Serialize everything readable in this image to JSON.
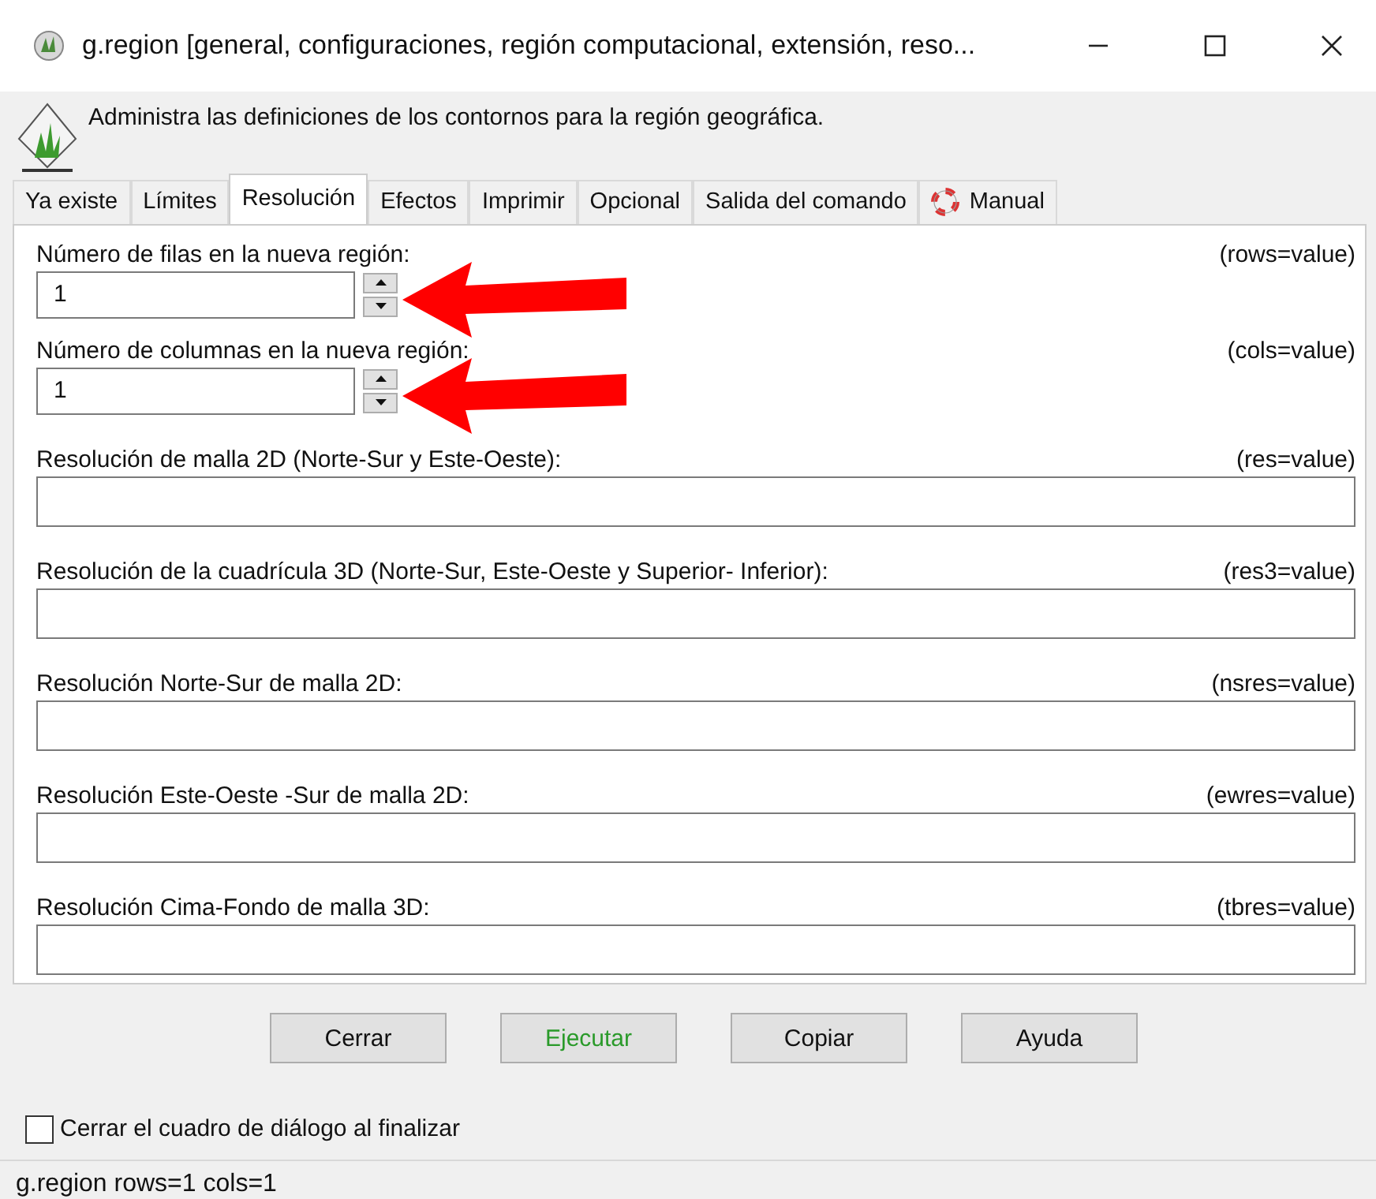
{
  "window": {
    "title": "g.region [general, configuraciones, región computacional, extensión, reso..."
  },
  "header": {
    "description": "Administra las definiciones de los contornos para la región geográfica."
  },
  "tabs": [
    {
      "label": "Ya existe",
      "selected": false,
      "kind": "text"
    },
    {
      "label": "Límites",
      "selected": false,
      "kind": "text"
    },
    {
      "label": "Resolución",
      "selected": true,
      "kind": "text"
    },
    {
      "label": "Efectos",
      "selected": false,
      "kind": "text"
    },
    {
      "label": "Imprimir",
      "selected": false,
      "kind": "text"
    },
    {
      "label": "Opcional",
      "selected": false,
      "kind": "text"
    },
    {
      "label": "Salida del comando",
      "selected": false,
      "kind": "text"
    },
    {
      "label": "Manual",
      "selected": false,
      "kind": "help"
    }
  ],
  "fields": [
    {
      "kind": "spin",
      "label": "Número de filas en la nueva región:",
      "param": "(rows=value)",
      "value": "1"
    },
    {
      "kind": "spin",
      "label": "Número de columnas en la nueva región:",
      "param": "(cols=value)",
      "value": "1"
    },
    {
      "kind": "text",
      "label": "Resolución de malla 2D (Norte-Sur y Este-Oeste):",
      "param": "(res=value)"
    },
    {
      "kind": "text",
      "label": "Resolución de la cuadrícula 3D (Norte-Sur, Este-Oeste y Superior-  Inferior):",
      "param": "(res3=value)"
    },
    {
      "kind": "text",
      "label": "Resolución Norte-Sur de malla 2D:",
      "param": "(nsres=value)"
    },
    {
      "kind": "text",
      "label": "Resolución Este-Oeste -Sur de malla 2D:",
      "param": "(ewres=value)"
    },
    {
      "kind": "text",
      "label": "Resolución Cima-Fondo de malla 3D:",
      "param": "(tbres=value)"
    }
  ],
  "buttons": [
    {
      "label": "Cerrar",
      "kind": "default"
    },
    {
      "label": "Ejecutar",
      "kind": "accent"
    },
    {
      "label": "Copiar",
      "kind": "default"
    },
    {
      "label": "Ayuda",
      "kind": "default"
    }
  ],
  "close_on_finish": {
    "label": "Cerrar el cuadro de diálogo al finalizar",
    "checked": false
  },
  "status_bar": {
    "text": "g.region rows=1 cols=1"
  }
}
